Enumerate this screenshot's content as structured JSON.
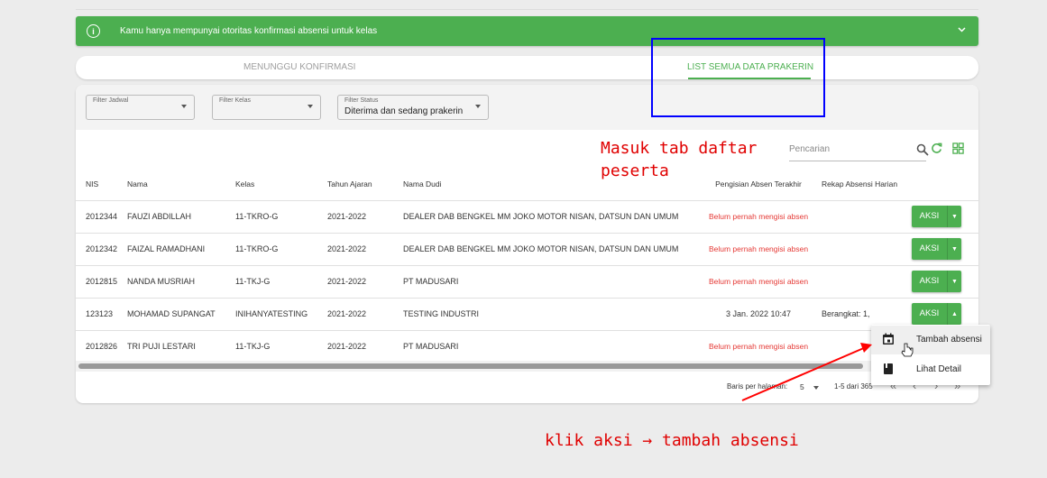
{
  "alert": {
    "icon": "info-icon",
    "message": "Kamu hanya mempunyai otoritas konfirmasi absensi untuk kelas",
    "expand_icon": "chevron-down-icon",
    "color": "#4caf50"
  },
  "tabs": [
    {
      "label": "MENUNGGU KONFIRMASI",
      "active": false
    },
    {
      "label": "LIST SEMUA DATA PRAKERIN",
      "active": true
    }
  ],
  "filters": {
    "jadwal": {
      "label": "Filter Jadwal",
      "value": ""
    },
    "kelas": {
      "label": "Filter Kelas",
      "value": ""
    },
    "status": {
      "label": "Filter Status",
      "value": "Diterima dan sedang prakerin"
    }
  },
  "search": {
    "placeholder": "Pencarian"
  },
  "table": {
    "headers": [
      "NIS",
      "Nama",
      "Kelas",
      "Tahun Ajaran",
      "Nama Dudi",
      "Pengisian Absen Terakhir",
      "Rekap Absensi Harian",
      ""
    ],
    "rows": [
      {
        "nis": "2012344",
        "nama": "FAUZI ABDILLAH",
        "kelas": "11-TKRO-G",
        "tahun": "2021-2022",
        "dudi": "DEALER DAB BENGKEL MM JOKO MOTOR NISAN, DATSUN DAN UMUM",
        "absen": "Belum pernah mengisi absen",
        "absen_red": true,
        "rekap": "",
        "aksi": "AKSI"
      },
      {
        "nis": "2012342",
        "nama": "FAIZAL RAMADHANI",
        "kelas": "11-TKRO-G",
        "tahun": "2021-2022",
        "dudi": "DEALER DAB BENGKEL MM JOKO MOTOR NISAN, DATSUN DAN UMUM",
        "absen": "Belum pernah mengisi absen",
        "absen_red": true,
        "rekap": "",
        "aksi": "AKSI"
      },
      {
        "nis": "2012815",
        "nama": "NANDA MUSRIAH",
        "kelas": "11-TKJ-G",
        "tahun": "2021-2022",
        "dudi": "PT MADUSARI",
        "absen": "Belum pernah mengisi absen",
        "absen_red": true,
        "rekap": "",
        "aksi": "AKSI"
      },
      {
        "nis": "123123",
        "nama": "MOHAMAD SUPANGAT",
        "kelas": "INIHANYATESTING",
        "tahun": "2021-2022",
        "dudi": "TESTING INDUSTRI",
        "absen": "3 Jan. 2022 10:47",
        "absen_red": false,
        "rekap": "Berangkat: 1,",
        "aksi": "AKSI"
      },
      {
        "nis": "2012826",
        "nama": "TRI PUJI LESTARI",
        "kelas": "11-TKJ-G",
        "tahun": "2021-2022",
        "dudi": "PT MADUSARI",
        "absen": "Belum pernah mengisi absen",
        "absen_red": true,
        "rekap": "",
        "aksi": ""
      }
    ]
  },
  "pagination": {
    "rows_label": "Baris per halaman:",
    "rows_value": "5",
    "range": "1-5 dari 365",
    "first": "«",
    "prev": "‹",
    "next": "›",
    "last": "»"
  },
  "menu": {
    "items": [
      {
        "label": "Tambah absensi",
        "icon": "calendar-icon"
      },
      {
        "label": "Lihat Detail",
        "icon": "book-icon"
      }
    ]
  },
  "annotations": {
    "tab_note": "Masuk tab daftar peserta",
    "action_note": "klik aksi → tambah absensi"
  }
}
